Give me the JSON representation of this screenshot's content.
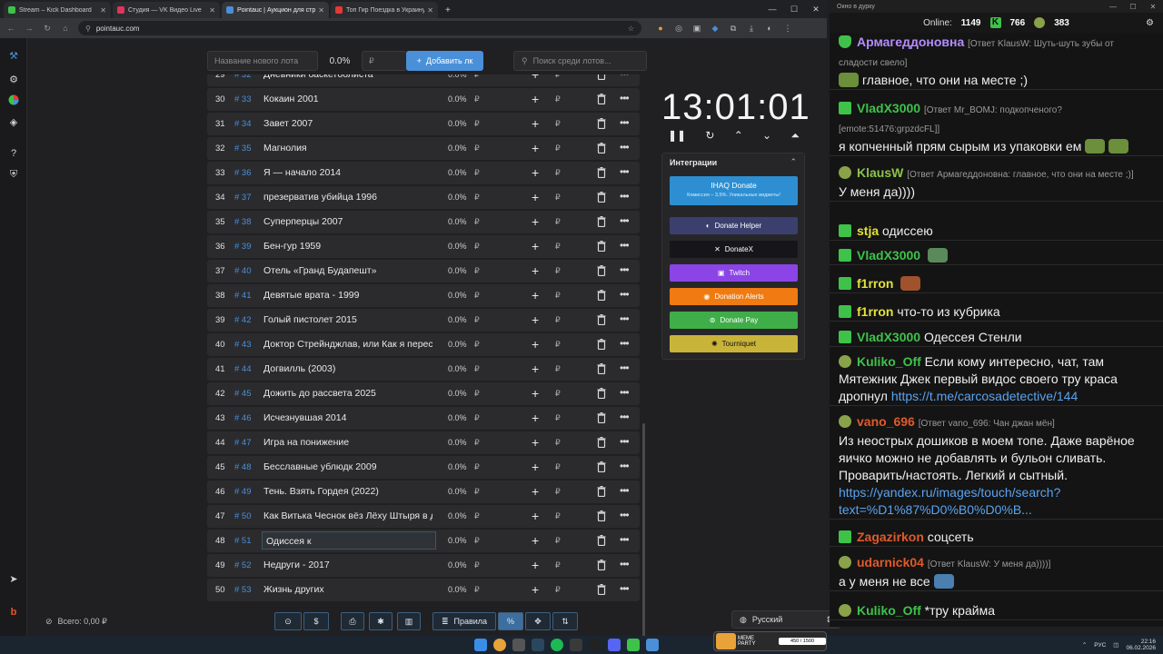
{
  "browser": {
    "tabs": [
      {
        "title": "Stream – Kick Dashboard",
        "color": "#3ec24a"
      },
      {
        "title": "Студия — VK Видео Live",
        "color": "#e0345c"
      },
      {
        "title": "Pointauc | Аукцион для стрим",
        "color": "#4a8fd8"
      },
      {
        "title": "Топ Гир Поездка в Украину (",
        "color": "#e53935"
      }
    ],
    "url": "pointauc.com"
  },
  "toolbar": {
    "lot_name_placeholder": "Название нового лота",
    "percent": "0.0%",
    "amount_placeholder": "₽",
    "add_label": "Добавить лк",
    "search_placeholder": "Поиск среди лотов..."
  },
  "lots": [
    {
      "num": "29",
      "id": "# 32",
      "name": "Дневники баскетболиста"
    },
    {
      "num": "30",
      "id": "# 33",
      "name": "Кокаин 2001"
    },
    {
      "num": "31",
      "id": "# 34",
      "name": "Завет 2007"
    },
    {
      "num": "32",
      "id": "# 35",
      "name": "Магнолия"
    },
    {
      "num": "33",
      "id": "# 36",
      "name": "Я — начало 2014"
    },
    {
      "num": "34",
      "id": "# 37",
      "name": "презерватив убийца 1996"
    },
    {
      "num": "35",
      "id": "# 38",
      "name": "Суперперцы 2007"
    },
    {
      "num": "36",
      "id": "# 39",
      "name": "Бен-гур 1959"
    },
    {
      "num": "37",
      "id": "# 40",
      "name": "Отель «Гранд Будапешт»"
    },
    {
      "num": "38",
      "id": "# 41",
      "name": "Девятые врата - 1999"
    },
    {
      "num": "39",
      "id": "# 42",
      "name": "Голый пистолет 2015"
    },
    {
      "num": "40",
      "id": "# 43",
      "name": "Доктор Стрейнджлав, или Как я перестал бояться"
    },
    {
      "num": "41",
      "id": "# 44",
      "name": "Догвилль (2003)"
    },
    {
      "num": "42",
      "id": "# 45",
      "name": "Дожить до рассвета 2025"
    },
    {
      "num": "43",
      "id": "# 46",
      "name": "Исчезнувшая 2014"
    },
    {
      "num": "44",
      "id": "# 47",
      "name": "Игра на понижение"
    },
    {
      "num": "45",
      "id": "# 48",
      "name": "Бесславные ублюдк 2009"
    },
    {
      "num": "46",
      "id": "# 49",
      "name": "Тень. Взять Гордея (2022)"
    },
    {
      "num": "47",
      "id": "# 50",
      "name": "Как Витька Чеснок вёз Лёху Штыря в дом инвалидов"
    },
    {
      "num": "48",
      "id": "# 51",
      "name": "Одиссея к",
      "editing": true
    },
    {
      "num": "49",
      "id": "# 52",
      "name": "Недруги - 2017"
    },
    {
      "num": "50",
      "id": "# 53",
      "name": "Жизнь других"
    }
  ],
  "lot_pct": "0.0%",
  "rub": "₽",
  "timer": {
    "value": "13:01:01"
  },
  "integrations": {
    "title": "Интеграции",
    "ihaq_title": "IHAQ Donate",
    "ihaq_sub": "Комиссия – 3,5%. Уникальные виджеты!",
    "buttons": [
      {
        "label": "Donate Helper",
        "color": "#3b3f6e"
      },
      {
        "label": "DonateX",
        "color": "#16161a"
      },
      {
        "label": "Twitch",
        "color": "#8b44e6"
      },
      {
        "label": "Donation Alerts",
        "color": "#f07b12"
      },
      {
        "label": "Donate Pay",
        "color": "#3fae49"
      },
      {
        "label": "Tourniquet",
        "color": "#c9b43a"
      }
    ]
  },
  "bottom": {
    "total_label": "Всего: 0,00 ₽",
    "rules_label": "Правила",
    "language": "Русский"
  },
  "chat": {
    "window_title": "Окно в дурку",
    "online_label": "Online:",
    "online": "1149",
    "kick_count": "766",
    "vk_count": "383",
    "messages": [
      {
        "user": "Армагеддоновна",
        "color": "#b58cff",
        "reply": "[Ответ KlausW: Шуть-шуть зубы от сладости свело]",
        "text": "главное, что они на месте ;)"
      },
      {
        "user": "VladX3000",
        "color": "#3ec24a",
        "reply": "[Ответ Mr_BOMJ: подкопченого?",
        "reply2": "[emote:51476:grpzdcFL]]",
        "text": "я копченный прям сырым из упаковки ем"
      },
      {
        "user": "KlausW",
        "color": "#8bc34a",
        "reply": "[Ответ Армагеддоновна: главное, что они на месте ;)]",
        "text": "У меня да))))"
      },
      {
        "user": "stja",
        "color": "#e2e23a",
        "text": "одиссею"
      },
      {
        "user": "VladX3000",
        "color": "#3ec24a",
        "text": ""
      },
      {
        "user": "f1rron",
        "color": "#e2e23a",
        "text": ""
      },
      {
        "user": "f1rron",
        "color": "#e2e23a",
        "text": "что-то из кубрика"
      },
      {
        "user": "VladX3000",
        "color": "#3ec24a",
        "text": "Одессея Стенли"
      },
      {
        "user": "Kuliko_Off",
        "color": "#3ec24a",
        "text": "Если кому интересно, чат, там Мятежник Джек первый видос своего тру краса дропнул",
        "link": "https://t.me/carcosadetective/144"
      },
      {
        "user": "vano_696",
        "color": "#e05a2a",
        "reply": "[Ответ vano_696: Чан джан мён]",
        "text": "Из неострых дошиков в моем топе. Даже варёное яичко можно не добавлять и бульон сливать. Проварить/настоять. Легкий и сытный.",
        "link": "https://yandex.ru/images/touch/search?text=%D1%87%D0%B0%D0%B..."
      },
      {
        "user": "Zagazirkon",
        "color": "#e05a2a",
        "text": "соцсеть"
      },
      {
        "user": "udarnick04",
        "color": "#e05a2a",
        "reply": "[Ответ KlausW: У меня да))))]",
        "text": "а у меня не все"
      },
      {
        "user": "Kuliko_Off",
        "color": "#3ec24a",
        "text": "*тру крайма"
      }
    ]
  },
  "taskbar": {
    "lang": "РУС",
    "time": "22:16",
    "date": "06.02.2026",
    "widget_title": "MEME PARTY",
    "widget_progress": "450 / 1500"
  }
}
